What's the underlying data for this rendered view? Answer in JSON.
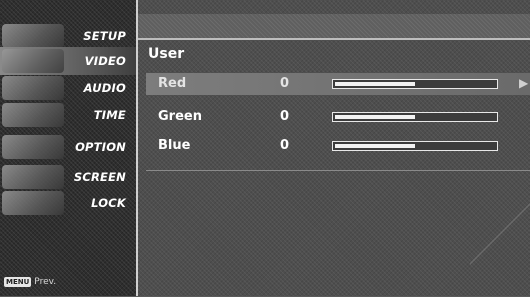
{
  "sidebar": {
    "items": [
      {
        "label": "SETUP"
      },
      {
        "label": "VIDEO"
      },
      {
        "label": "AUDIO"
      },
      {
        "label": "TIME"
      },
      {
        "label": "OPTION"
      },
      {
        "label": "SCREEN"
      },
      {
        "label": "LOCK"
      }
    ],
    "active_index": 1,
    "hint": {
      "key": "MENU",
      "text": "Prev."
    }
  },
  "main": {
    "section_title": "User",
    "rows": [
      {
        "label": "Red",
        "value": "0",
        "level_percent": 50
      },
      {
        "label": "Green",
        "value": "0",
        "level_percent": 50
      },
      {
        "label": "Blue",
        "value": "0",
        "level_percent": 50
      }
    ],
    "selected_row": 0,
    "next_indicator": "▶"
  },
  "colors": {
    "background": "#4e4e4e",
    "highlight": "#7d7d7d",
    "text": "#ffffff"
  }
}
